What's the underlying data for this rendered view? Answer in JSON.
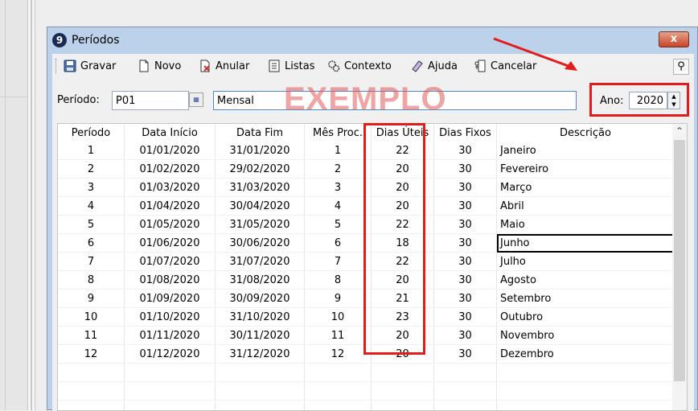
{
  "window": {
    "title": "Períodos",
    "close_label": "x"
  },
  "toolbar": {
    "gravar": "Gravar",
    "novo": "Novo",
    "anular": "Anular",
    "listas": "Listas",
    "contexto": "Contexto",
    "ajuda": "Ajuda",
    "cancelar": "Cancelar"
  },
  "form": {
    "periodo_label": "Período:",
    "periodo_value": "P01",
    "descricao_value": "Mensal",
    "watermark": "EXEMPLO",
    "ano_label": "Ano:",
    "ano_value": "2020"
  },
  "table": {
    "headers": [
      "Período",
      "Data Início",
      "Data Fim",
      "Mês Proc.",
      "Dias Úteis",
      "Dias Fixos",
      "Descrição"
    ],
    "rows": [
      [
        "1",
        "01/01/2020",
        "31/01/2020",
        "1",
        "22",
        "30",
        "Janeiro"
      ],
      [
        "2",
        "01/02/2020",
        "29/02/2020",
        "2",
        "20",
        "30",
        "Fevereiro"
      ],
      [
        "3",
        "01/03/2020",
        "31/03/2020",
        "3",
        "20",
        "30",
        "Março"
      ],
      [
        "4",
        "01/04/2020",
        "30/04/2020",
        "4",
        "20",
        "30",
        "Abril"
      ],
      [
        "5",
        "01/05/2020",
        "31/05/2020",
        "5",
        "22",
        "30",
        "Maio"
      ],
      [
        "6",
        "01/06/2020",
        "30/06/2020",
        "6",
        "18",
        "30",
        "Junho"
      ],
      [
        "7",
        "01/07/2020",
        "31/07/2020",
        "7",
        "22",
        "30",
        "Julho"
      ],
      [
        "8",
        "01/08/2020",
        "31/08/2020",
        "8",
        "20",
        "30",
        "Agosto"
      ],
      [
        "9",
        "01/09/2020",
        "30/09/2020",
        "9",
        "21",
        "30",
        "Setembro"
      ],
      [
        "10",
        "01/10/2020",
        "31/10/2020",
        "10",
        "23",
        "30",
        "Outubro"
      ],
      [
        "11",
        "01/11/2020",
        "30/11/2020",
        "11",
        "20",
        "30",
        "Novembro"
      ],
      [
        "12",
        "01/12/2020",
        "31/12/2020",
        "12",
        "20",
        "30",
        "Dezembro"
      ]
    ],
    "selected_row": 5
  },
  "colors": {
    "highlight": "#e31b1b",
    "title_bar": "#bcd2ea",
    "close": "#c8452a"
  },
  "icons": [
    "app-logo-icon",
    "save-icon",
    "new-document-icon",
    "cancel-document-icon",
    "list-icon",
    "gears-icon",
    "help-icon",
    "exit-icon",
    "search-icon",
    "calendar-icon"
  ]
}
